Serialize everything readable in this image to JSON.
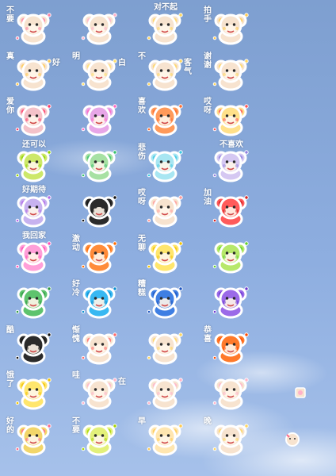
{
  "stickers": [
    {
      "id": "r1c1",
      "text": "不要",
      "text2": "",
      "body": "#f7e3cf",
      "accent": "#ff7fa3"
    },
    {
      "id": "r1c2",
      "text": "",
      "text2": "",
      "body": "#f7e3cf",
      "accent": "#ffb2c9"
    },
    {
      "id": "r1c3",
      "text": "对不起",
      "text2": "",
      "body": "#f7e3cf",
      "accent": "#ffd65c"
    },
    {
      "id": "r1c4",
      "text": "拍手",
      "text2": "",
      "body": "#f7e3cf",
      "accent": "#ffc94d"
    },
    {
      "id": "r2c1",
      "text": "真",
      "text2": "好",
      "body": "#f7e3cf",
      "accent": "#ffc94d"
    },
    {
      "id": "r2c2",
      "text": "明",
      "text2": "白",
      "body": "#f7e3cf",
      "accent": "#ffe06d"
    },
    {
      "id": "r2c3",
      "text": "不",
      "text2": "客气",
      "body": "#f7e3cf",
      "accent": "#ffd65c"
    },
    {
      "id": "r2c4",
      "text": "谢谢",
      "text2": "",
      "body": "#f7e3cf",
      "accent": "#ffd65c"
    },
    {
      "id": "r3c1",
      "text": "爱你",
      "text2": "",
      "body": "#f4c2c9",
      "accent": "#ff3b68"
    },
    {
      "id": "r3c2",
      "text": "",
      "text2": "",
      "body": "#e7a6e7",
      "accent": "#ff69c2"
    },
    {
      "id": "r3c3",
      "text": "喜欢",
      "text2": "",
      "body": "#ff9a5a",
      "accent": "#ff6a2a"
    },
    {
      "id": "r3c4",
      "text": "哎呀",
      "text2": "",
      "body": "#ffe08a",
      "accent": "#ff5252"
    },
    {
      "id": "r4c1",
      "text": "还可以",
      "text2": "",
      "body": "#cde86a",
      "accent": "#8fd400"
    },
    {
      "id": "r4c2",
      "text": "",
      "text2": "",
      "body": "#a7e1a3",
      "accent": "#38c26d"
    },
    {
      "id": "r4c3",
      "text": "悲伤",
      "text2": "",
      "body": "#a8e6f2",
      "accent": "#3cc8e3"
    },
    {
      "id": "r4c4",
      "text": "不喜欢",
      "text2": "",
      "body": "#d5c8f2",
      "accent": "#8f7fdf"
    },
    {
      "id": "r5c1",
      "text": "好期待",
      "text2": "",
      "body": "#c7b2ef",
      "accent": "#b36ae8"
    },
    {
      "id": "r5c2",
      "text": "",
      "text2": "",
      "body": "#2b2b2b",
      "accent": "#111111"
    },
    {
      "id": "r5c3",
      "text": "哎呀",
      "text2": "",
      "body": "#f7e3cf",
      "accent": "#ff9a9a"
    },
    {
      "id": "r5c4",
      "text": "加油",
      "text2": "",
      "body": "#ff5b5b",
      "accent": "#d41f1f"
    },
    {
      "id": "r6c1",
      "text": "我回家",
      "text2": "",
      "body": "#ff9fd8",
      "accent": "#ff4fb5"
    },
    {
      "id": "r6c2",
      "text": "激动",
      "text2": "",
      "body": "#ff8c3a",
      "accent": "#ff6a00"
    },
    {
      "id": "r6c3",
      "text": "无聊",
      "text2": "",
      "body": "#ffe66d",
      "accent": "#f2c200"
    },
    {
      "id": "r6c4",
      "text": "",
      "text2": "",
      "body": "#b7e86a",
      "accent": "#5fcf2a"
    },
    {
      "id": "r7c1",
      "text": "",
      "text2": "",
      "body": "#5ec36d",
      "accent": "#2f9a45"
    },
    {
      "id": "r7c2",
      "text": "好冷",
      "text2": "",
      "body": "#38b8f2",
      "accent": "#0a8fd0"
    },
    {
      "id": "r7c3",
      "text": "糟糕",
      "text2": "",
      "body": "#3f7fe3",
      "accent": "#1d55c0"
    },
    {
      "id": "r7c4",
      "text": "",
      "text2": "",
      "body": "#9b6ae8",
      "accent": "#6a38cf"
    },
    {
      "id": "r8c1",
      "text": "酷",
      "text2": "",
      "body": "#2b2b2b",
      "accent": "#111111"
    },
    {
      "id": "r8c2",
      "text": "惭愧",
      "text2": "",
      "body": "#f7e3cf",
      "accent": "#ff6a6a"
    },
    {
      "id": "r8c3",
      "text": "",
      "text2": "",
      "body": "#f7e3cf",
      "accent": "#ffd65c"
    },
    {
      "id": "r8c4",
      "text": "恭喜",
      "text2": "",
      "body": "#ff7a2a",
      "accent": "#ff4a00"
    },
    {
      "id": "r9c1",
      "text": "饿了",
      "text2": "",
      "body": "#ffe66d",
      "accent": "#f2c200"
    },
    {
      "id": "r9c2",
      "text": "哇",
      "text2": "在",
      "body": "#f7e3cf",
      "accent": "#ffb2c9"
    },
    {
      "id": "r9c3",
      "text": "",
      "text2": "",
      "body": "#f7e3cf",
      "accent": "#ffb2c9"
    },
    {
      "id": "r9c4",
      "text": "",
      "text2": "",
      "body": "#f7e3cf",
      "accent": "#ffb2c9"
    },
    {
      "id": "r10c1",
      "text": "好的",
      "text2": "",
      "body": "#f2d66a",
      "accent": "#ff6a8a"
    },
    {
      "id": "r10c2",
      "text": "不要",
      "text2": "",
      "body": "#e3f07a",
      "accent": "#a7d400"
    },
    {
      "id": "r10c3",
      "text": "早",
      "text2": "",
      "body": "#ffe6b0",
      "accent": "#ffc94d"
    },
    {
      "id": "r10c4",
      "text": "晚",
      "text2": "",
      "body": "#f7e3cf",
      "accent": "#ffd65c"
    }
  ]
}
